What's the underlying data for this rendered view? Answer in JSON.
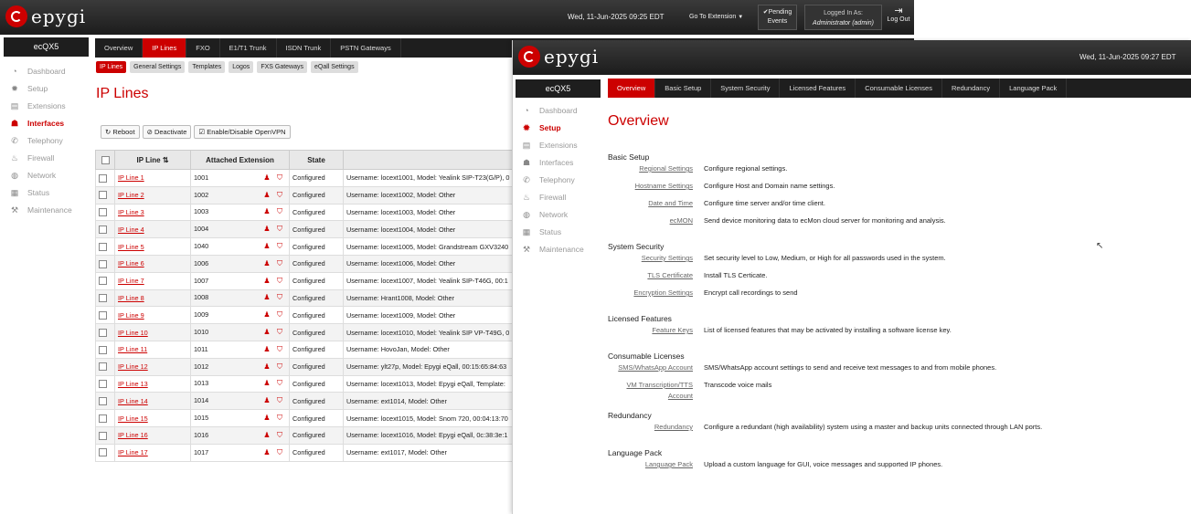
{
  "window1": {
    "brand": "epygi",
    "datetime": "Wed, 11-Jun-2025 09:25 EDT",
    "goto_label": "Go To Extension",
    "pending_label1": "Pending",
    "pending_label2": "Events",
    "logged_label": "Logged In As:",
    "logged_user": "Administrator (admin)",
    "logout_label": "Log Out",
    "device": "ecQX5",
    "sidebar": [
      {
        "label": "Dashboard",
        "icon": "dashboard-icon"
      },
      {
        "label": "Setup",
        "icon": "gear-icon"
      },
      {
        "label": "Extensions",
        "icon": "extensions-icon"
      },
      {
        "label": "Interfaces",
        "icon": "interfaces-icon",
        "active": true
      },
      {
        "label": "Telephony",
        "icon": "phone-icon"
      },
      {
        "label": "Firewall",
        "icon": "fire-icon"
      },
      {
        "label": "Network",
        "icon": "globe-icon"
      },
      {
        "label": "Status",
        "icon": "chart-icon"
      },
      {
        "label": "Maintenance",
        "icon": "wrench-icon"
      }
    ],
    "tabs": [
      "Overview",
      "IP Lines",
      "FXO",
      "E1/T1 Trunk",
      "ISDN Trunk",
      "PSTN Gateways"
    ],
    "active_tab": "IP Lines",
    "subtabs": [
      "IP Lines",
      "General Settings",
      "Templates",
      "Logos",
      "FXS Gateways",
      "eQall Settings"
    ],
    "page_title": "IP Lines",
    "actions": [
      "Reboot",
      "Deactivate",
      "Enable/Disable OpenVPN"
    ],
    "columns": [
      "IP Line",
      "Attached Extension",
      "State",
      ""
    ],
    "rows": [
      {
        "line": "IP Line 1",
        "ext": "1001",
        "state": "Configured",
        "info": "Username: locext1001, Model: Yealink SIP-T23(G/P), 0"
      },
      {
        "line": "IP Line 2",
        "ext": "1002",
        "state": "Configured",
        "info": "Username: locext1002, Model: Other"
      },
      {
        "line": "IP Line 3",
        "ext": "1003",
        "state": "Configured",
        "info": "Username: locext1003, Model: Other"
      },
      {
        "line": "IP Line 4",
        "ext": "1004",
        "state": "Configured",
        "info": "Username: locext1004, Model: Other"
      },
      {
        "line": "IP Line 5",
        "ext": "1040",
        "state": "Configured",
        "info": "Username: locext1005, Model: Grandstream GXV3240"
      },
      {
        "line": "IP Line 6",
        "ext": "1006",
        "state": "Configured",
        "info": "Username: locext1006, Model: Other"
      },
      {
        "line": "IP Line 7",
        "ext": "1007",
        "state": "Configured",
        "info": "Username: locext1007, Model: Yealink SIP-T46G, 00:1"
      },
      {
        "line": "IP Line 8",
        "ext": "1008",
        "state": "Configured",
        "info": "Username: Hrant1008, Model: Other"
      },
      {
        "line": "IP Line 9",
        "ext": "1009",
        "state": "Configured",
        "info": "Username: locext1009, Model: Other"
      },
      {
        "line": "IP Line 10",
        "ext": "1010",
        "state": "Configured",
        "info": "Username: locext1010, Model: Yealink SIP VP-T49G, 0"
      },
      {
        "line": "IP Line 11",
        "ext": "1011",
        "state": "Configured",
        "info": "Username: HovoJan, Model: Other"
      },
      {
        "line": "IP Line 12",
        "ext": "1012",
        "state": "Configured",
        "info": "Username: ylt27p, Model: Epygi eQall, 00:15:65:84:63"
      },
      {
        "line": "IP Line 13",
        "ext": "1013",
        "state": "Configured",
        "info": "Username: locext1013, Model: Epygi eQall, Template:"
      },
      {
        "line": "IP Line 14",
        "ext": "1014",
        "state": "Configured",
        "info": "Username: ext1014, Model: Other"
      },
      {
        "line": "IP Line 15",
        "ext": "1015",
        "state": "Configured",
        "info": "Username: locext1015, Model: Snom 720, 00:04:13:70"
      },
      {
        "line": "IP Line 16",
        "ext": "1016",
        "state": "Configured",
        "info": "Username: locext1016, Model: Epygi eQall, 0c:38:3e:1"
      },
      {
        "line": "IP Line 17",
        "ext": "1017",
        "state": "Configured",
        "info": "Username: ext1017, Model: Other"
      }
    ]
  },
  "window2": {
    "brand": "epygi",
    "datetime": "Wed, 11-Jun-2025 09:27 EDT",
    "device": "ecQX5",
    "sidebar": [
      {
        "label": "Dashboard",
        "icon": "dashboard-icon"
      },
      {
        "label": "Setup",
        "icon": "gear-icon",
        "active": true
      },
      {
        "label": "Extensions",
        "icon": "extensions-icon"
      },
      {
        "label": "Interfaces",
        "icon": "interfaces-icon"
      },
      {
        "label": "Telephony",
        "icon": "phone-icon"
      },
      {
        "label": "Firewall",
        "icon": "fire-icon"
      },
      {
        "label": "Network",
        "icon": "globe-icon"
      },
      {
        "label": "Status",
        "icon": "chart-icon"
      },
      {
        "label": "Maintenance",
        "icon": "wrench-icon"
      }
    ],
    "tabs": [
      "Overview",
      "Basic Setup",
      "System Security",
      "Licensed Features",
      "Consumable Licenses",
      "Redundancy",
      "Language Pack"
    ],
    "active_tab": "Overview",
    "page_title": "Overview",
    "sections": [
      {
        "title": "Basic Setup",
        "items": [
          {
            "label": "Regional Settings",
            "desc": "Configure regional settings."
          },
          {
            "label": "Hostname Settings",
            "desc": "Configure Host and Domain name settings."
          },
          {
            "label": "Date and Time",
            "desc": "Configure time server and/or time client."
          },
          {
            "label": "ecMON",
            "desc": "Send device monitoring data to ecMon cloud server for monitoring and analysis."
          }
        ]
      },
      {
        "title": "System Security",
        "items": [
          {
            "label": "Security Settings",
            "desc": "Set security level to Low, Medium, or High for all passwords used in the system."
          },
          {
            "label": "TLS Certificate",
            "desc": "Install TLS Certicate."
          },
          {
            "label": "Encryption Settings",
            "desc": "Encrypt call recordings to send"
          }
        ]
      },
      {
        "title": "Licensed Features",
        "items": [
          {
            "label": "Feature Keys",
            "desc": "List of licensed features that may be activated by installing a software license key."
          }
        ]
      },
      {
        "title": "Consumable Licenses",
        "items": [
          {
            "label": "SMS/WhatsApp Account",
            "desc": "SMS/WhatsApp account settings to send and receive text messages to and from mobile phones."
          },
          {
            "label": "VM Transcription/TTS Account",
            "desc": "Transcode voice mails"
          }
        ]
      },
      {
        "title": "Redundancy",
        "items": [
          {
            "label": "Redundancy",
            "desc": "Configure a redundant (high availability) system using a master and backup units connected through LAN ports."
          }
        ]
      },
      {
        "title": "Language Pack",
        "items": [
          {
            "label": "Language Pack",
            "desc": "Upload a custom language for GUI, voice messages and supported IP phones."
          }
        ]
      }
    ]
  }
}
